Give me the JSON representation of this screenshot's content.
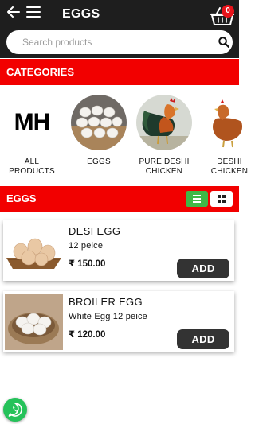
{
  "header": {
    "title": "EGGS",
    "cart_count": "0",
    "back_icon": "arrow-left-icon",
    "menu_icon": "hamburger-menu-icon",
    "cart_icon": "shopping-basket-icon"
  },
  "search": {
    "placeholder": "Search products",
    "icon": "search-icon"
  },
  "categories": {
    "title": "CATEGORIES",
    "items": [
      {
        "label": "ALL PRODUCTS",
        "image_text": "MH"
      },
      {
        "label": "EGGS"
      },
      {
        "label": "PURE DESHI CHICKEN"
      },
      {
        "label": "DESHI CHICKEN"
      }
    ]
  },
  "products_section": {
    "title": "EGGS",
    "view_toggle": {
      "active": "list",
      "list_icon": "list-view-icon",
      "grid_icon": "grid-view-icon"
    }
  },
  "products": [
    {
      "name": "DESI EGG",
      "desc": "12 peice",
      "price": "₹ 150.00",
      "add_label": "ADD"
    },
    {
      "name": "BROILER EGG",
      "desc": "White Egg 12 peice",
      "price": "₹ 120.00",
      "add_label": "ADD"
    }
  ],
  "colors": {
    "header_bg": "#1e1e1e",
    "accent_red": "#f20000",
    "add_button": "#333333",
    "list_toggle_active": "#3fb846",
    "whatsapp_green": "#25c25a"
  },
  "floating": {
    "whatsapp_icon": "whatsapp-icon"
  }
}
